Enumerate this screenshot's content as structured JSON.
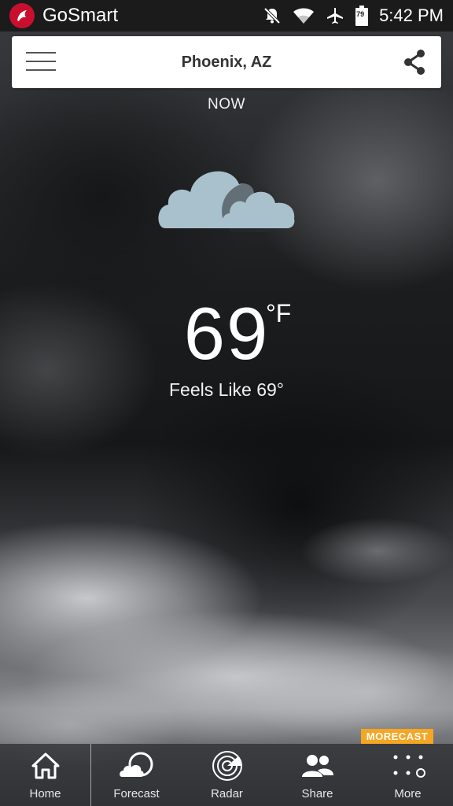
{
  "status_bar": {
    "carrier": "GoSmart",
    "battery_level": "79",
    "time": "5:42 PM",
    "icons": [
      "notifications-off-icon",
      "wifi-icon",
      "airplane-icon",
      "battery-icon"
    ]
  },
  "header": {
    "menu_icon": "hamburger-menu-icon",
    "location": "Phoenix, AZ",
    "share_icon": "share-icon"
  },
  "current": {
    "period_label": "NOW",
    "condition_icon": "partly-cloudy-clouds-icon",
    "temperature": "69",
    "unit": "°F",
    "feels_like": "Feels Like 69°"
  },
  "brand_badge": "MORECAST",
  "bottom_nav": [
    {
      "label": "Home",
      "icon": "home-icon"
    },
    {
      "label": "Forecast",
      "icon": "forecast-icon"
    },
    {
      "label": "Radar",
      "icon": "radar-icon"
    },
    {
      "label": "Share",
      "icon": "people-icon"
    },
    {
      "label": "More",
      "icon": "more-dots-icon"
    }
  ],
  "colors": {
    "status_bar_bg": "#1b1b1b",
    "cloud_icon": "#a9c1cd",
    "badge": "#f5a623",
    "carrier_red": "#c8102e"
  }
}
